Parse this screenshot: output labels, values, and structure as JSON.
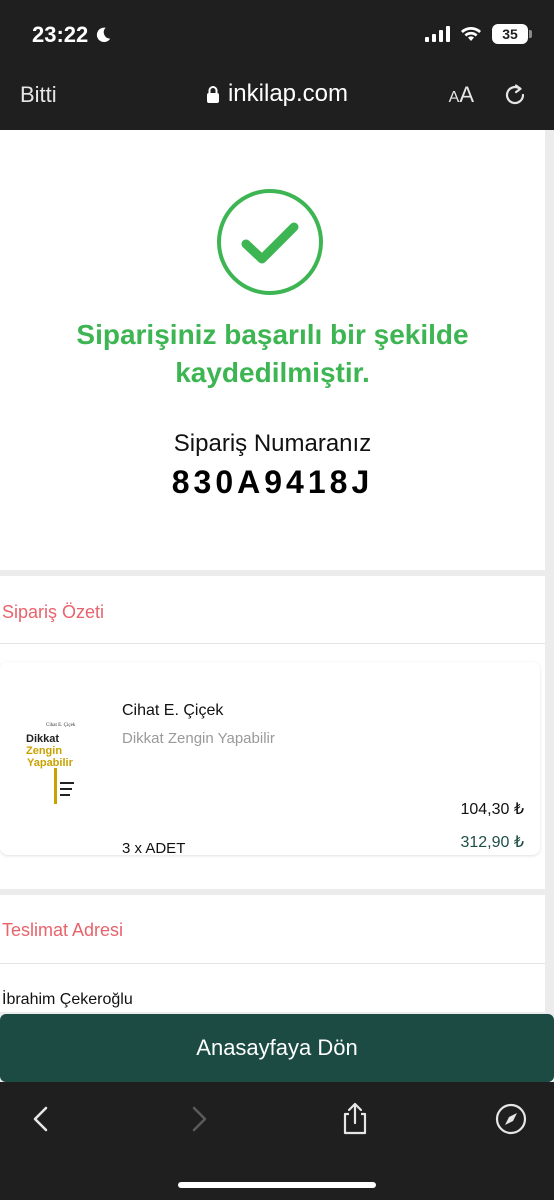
{
  "status_bar": {
    "time": "23:22",
    "battery": "35"
  },
  "nav": {
    "done": "Bitti",
    "url": "inkilap.com",
    "text_size_small": "A",
    "text_size_large": "A"
  },
  "success": {
    "message": "Siparişiniz başarılı bir şekilde kaydedilmiştir.",
    "order_label": "Sipariş Numaranız",
    "order_number": "830A9418J"
  },
  "summary": {
    "title": "Sipariş Özeti",
    "item": {
      "author": "Cihat E. Çiçek",
      "title": "Dikkat Zengin Yapabilir",
      "cover_author": "Cihat E. Çiçek",
      "cover_title_1": "Dikkat",
      "cover_title_2": "Zengin",
      "cover_title_3": "Yapabilir",
      "unit_price": "104,30 ₺",
      "quantity": "3 x ADET",
      "total_price": "312,90 ₺"
    }
  },
  "address": {
    "title": "Teslimat Adresi",
    "recipient": "İbrahim Çekeroğlu"
  },
  "home_button": "Anasayfaya Dön",
  "colors": {
    "success_green": "#3db552",
    "section_red": "#e8636c",
    "primary_dark_green": "#1b4b43",
    "bar_dark": "#1f1f1f"
  }
}
